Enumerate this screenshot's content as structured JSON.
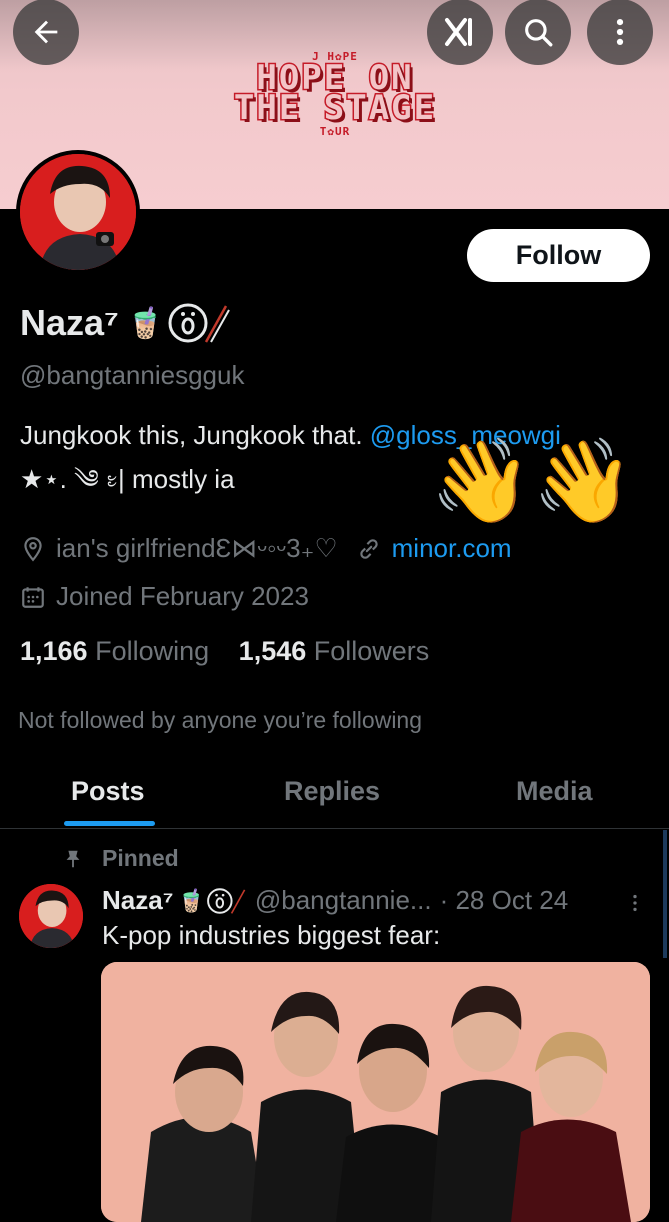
{
  "banner": {
    "artist": "J H✿PE",
    "title_line1": "HOPE ON",
    "title_line2": "THE STAGE",
    "tour": "T✿UR",
    "bg_color": "#f4c8cb"
  },
  "topbar": {
    "back_icon": "arrow-left-icon",
    "grok_icon": "grok-icon",
    "search_icon": "search-icon",
    "more_icon": "more-vertical-icon"
  },
  "profile": {
    "follow_label": "Follow",
    "name": "Naza⁷",
    "name_emoji": "🧋",
    "handle": "@bangtanniesgguk",
    "bio_line1": "Jungkook this, Jungkook that. ",
    "bio_mention": "@gloss_meowgi",
    "bio_line2": "★⋆. ༄ ᭝| mostly ia",
    "waving_emoji": "👋👋",
    "location": "ian's girlfriendƐ⋈ᵕ◦ᵕ3₊♡",
    "website": "minor.com",
    "joined": "Joined February 2023",
    "following_count": "1,166",
    "following_label": "Following",
    "followers_count": "1,546",
    "followers_label": "Followers",
    "not_followed": "Not followed by anyone you’re following"
  },
  "tabs": [
    {
      "label": "Posts",
      "active": true
    },
    {
      "label": "Replies",
      "active": false
    },
    {
      "label": "Media",
      "active": false
    }
  ],
  "post": {
    "pinned_label": "Pinned",
    "author_name": "Naza⁷",
    "author_emoji": "🧋",
    "author_handle": "@bangtannie...",
    "date": "· 28 Oct 24",
    "text": "K-pop industries biggest fear:"
  },
  "colors": {
    "accent": "#1d9bf0",
    "text_primary": "#e7e9ea",
    "text_secondary": "#71767b",
    "background": "#000000"
  }
}
